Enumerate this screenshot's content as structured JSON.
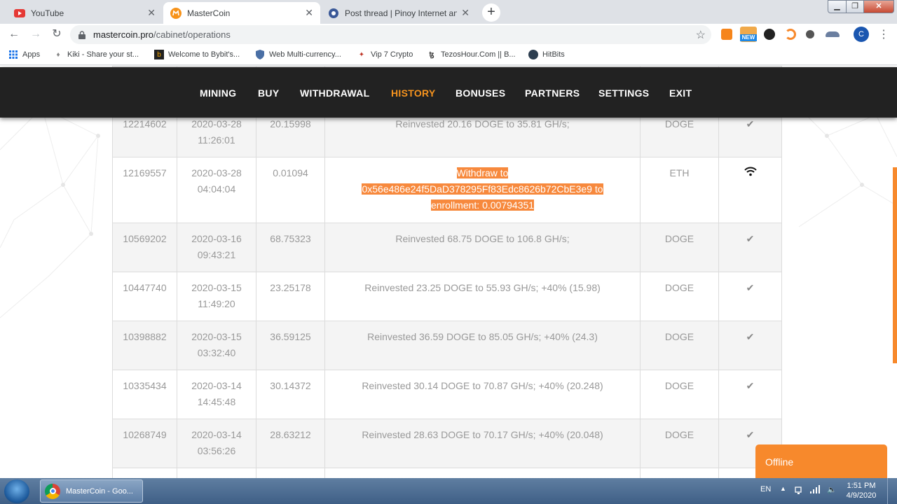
{
  "browser": {
    "tabs": [
      {
        "title": "YouTube"
      },
      {
        "title": "MasterCoin"
      },
      {
        "title": "Post thread | Pinoy Internet and T"
      }
    ],
    "url_domain": "mastercoin.pro",
    "url_path": "/cabinet/operations",
    "avatar_letter": "C",
    "ext_new_badge": "NEW",
    "bookmarks": [
      {
        "label": "Apps",
        "icon": "apps-grid-icon"
      },
      {
        "label": "Kiki - Share your st...",
        "icon": "kiki-icon"
      },
      {
        "label": "Welcome to Bybit's...",
        "icon": "bybit-icon"
      },
      {
        "label": "Web Multi-currency...",
        "icon": "shield-icon"
      },
      {
        "label": "Vip 7 Crypto",
        "icon": "crypto-icon"
      },
      {
        "label": "TezosHour.Com || B...",
        "icon": "tezos-icon"
      },
      {
        "label": "HitBits",
        "icon": "hitbits-icon"
      }
    ]
  },
  "site": {
    "accent_color": "#f7941e",
    "nav": [
      "MINING",
      "BUY",
      "WITHDRAWAL",
      "HISTORY",
      "BONUSES",
      "PARTNERS",
      "SETTINGS",
      "EXIT"
    ],
    "active_nav": "HISTORY",
    "operations": [
      {
        "id": "12214602",
        "date": "2020-03-28",
        "time": "11:26:01",
        "amount": "20.15998",
        "description": "Reinvested 20.16 DOGE to 35.81 GH/s;",
        "currency": "DOGE",
        "status_icon": "checkmark-icon"
      },
      {
        "id": "12169557",
        "date": "2020-03-28",
        "time": "04:04:04",
        "amount": "0.01094",
        "description_lines": [
          "Withdraw to",
          "0x56e486e24f5DaD378295Ff83Edc8626b72CbE3e9 to",
          "enrollment: 0.00794351"
        ],
        "currency": "ETH",
        "status_icon": "wifi-pending-icon"
      },
      {
        "id": "10569202",
        "date": "2020-03-16",
        "time": "09:43:21",
        "amount": "68.75323",
        "description": "Reinvested 68.75 DOGE to 106.8 GH/s;",
        "currency": "DOGE",
        "status_icon": "checkmark-icon"
      },
      {
        "id": "10447740",
        "date": "2020-03-15",
        "time": "11:49:20",
        "amount": "23.25178",
        "description": "Reinvested 23.25 DOGE to 55.93 GH/s; +40% (15.98)",
        "currency": "DOGE",
        "status_icon": "checkmark-icon"
      },
      {
        "id": "10398882",
        "date": "2020-03-15",
        "time": "03:32:40",
        "amount": "36.59125",
        "description": "Reinvested 36.59 DOGE to 85.05 GH/s; +40% (24.3)",
        "currency": "DOGE",
        "status_icon": "checkmark-icon"
      },
      {
        "id": "10335434",
        "date": "2020-03-14",
        "time": "14:45:48",
        "amount": "30.14372",
        "description": "Reinvested 30.14 DOGE to 70.87 GH/s; +40% (20.248)",
        "currency": "DOGE",
        "status_icon": "checkmark-icon"
      },
      {
        "id": "10268749",
        "date": "2020-03-14",
        "time": "03:56:26",
        "amount": "28.63212",
        "description": "Reinvested 28.63 DOGE to 70.17 GH/s; +40% (20.048)",
        "currency": "DOGE",
        "status_icon": "checkmark-icon"
      }
    ],
    "chat_widget": "Offline"
  },
  "taskbar": {
    "task_label": "MasterCoin - Goo...",
    "lang": "EN",
    "time": "1:51 PM",
    "date": "4/9/2020"
  }
}
